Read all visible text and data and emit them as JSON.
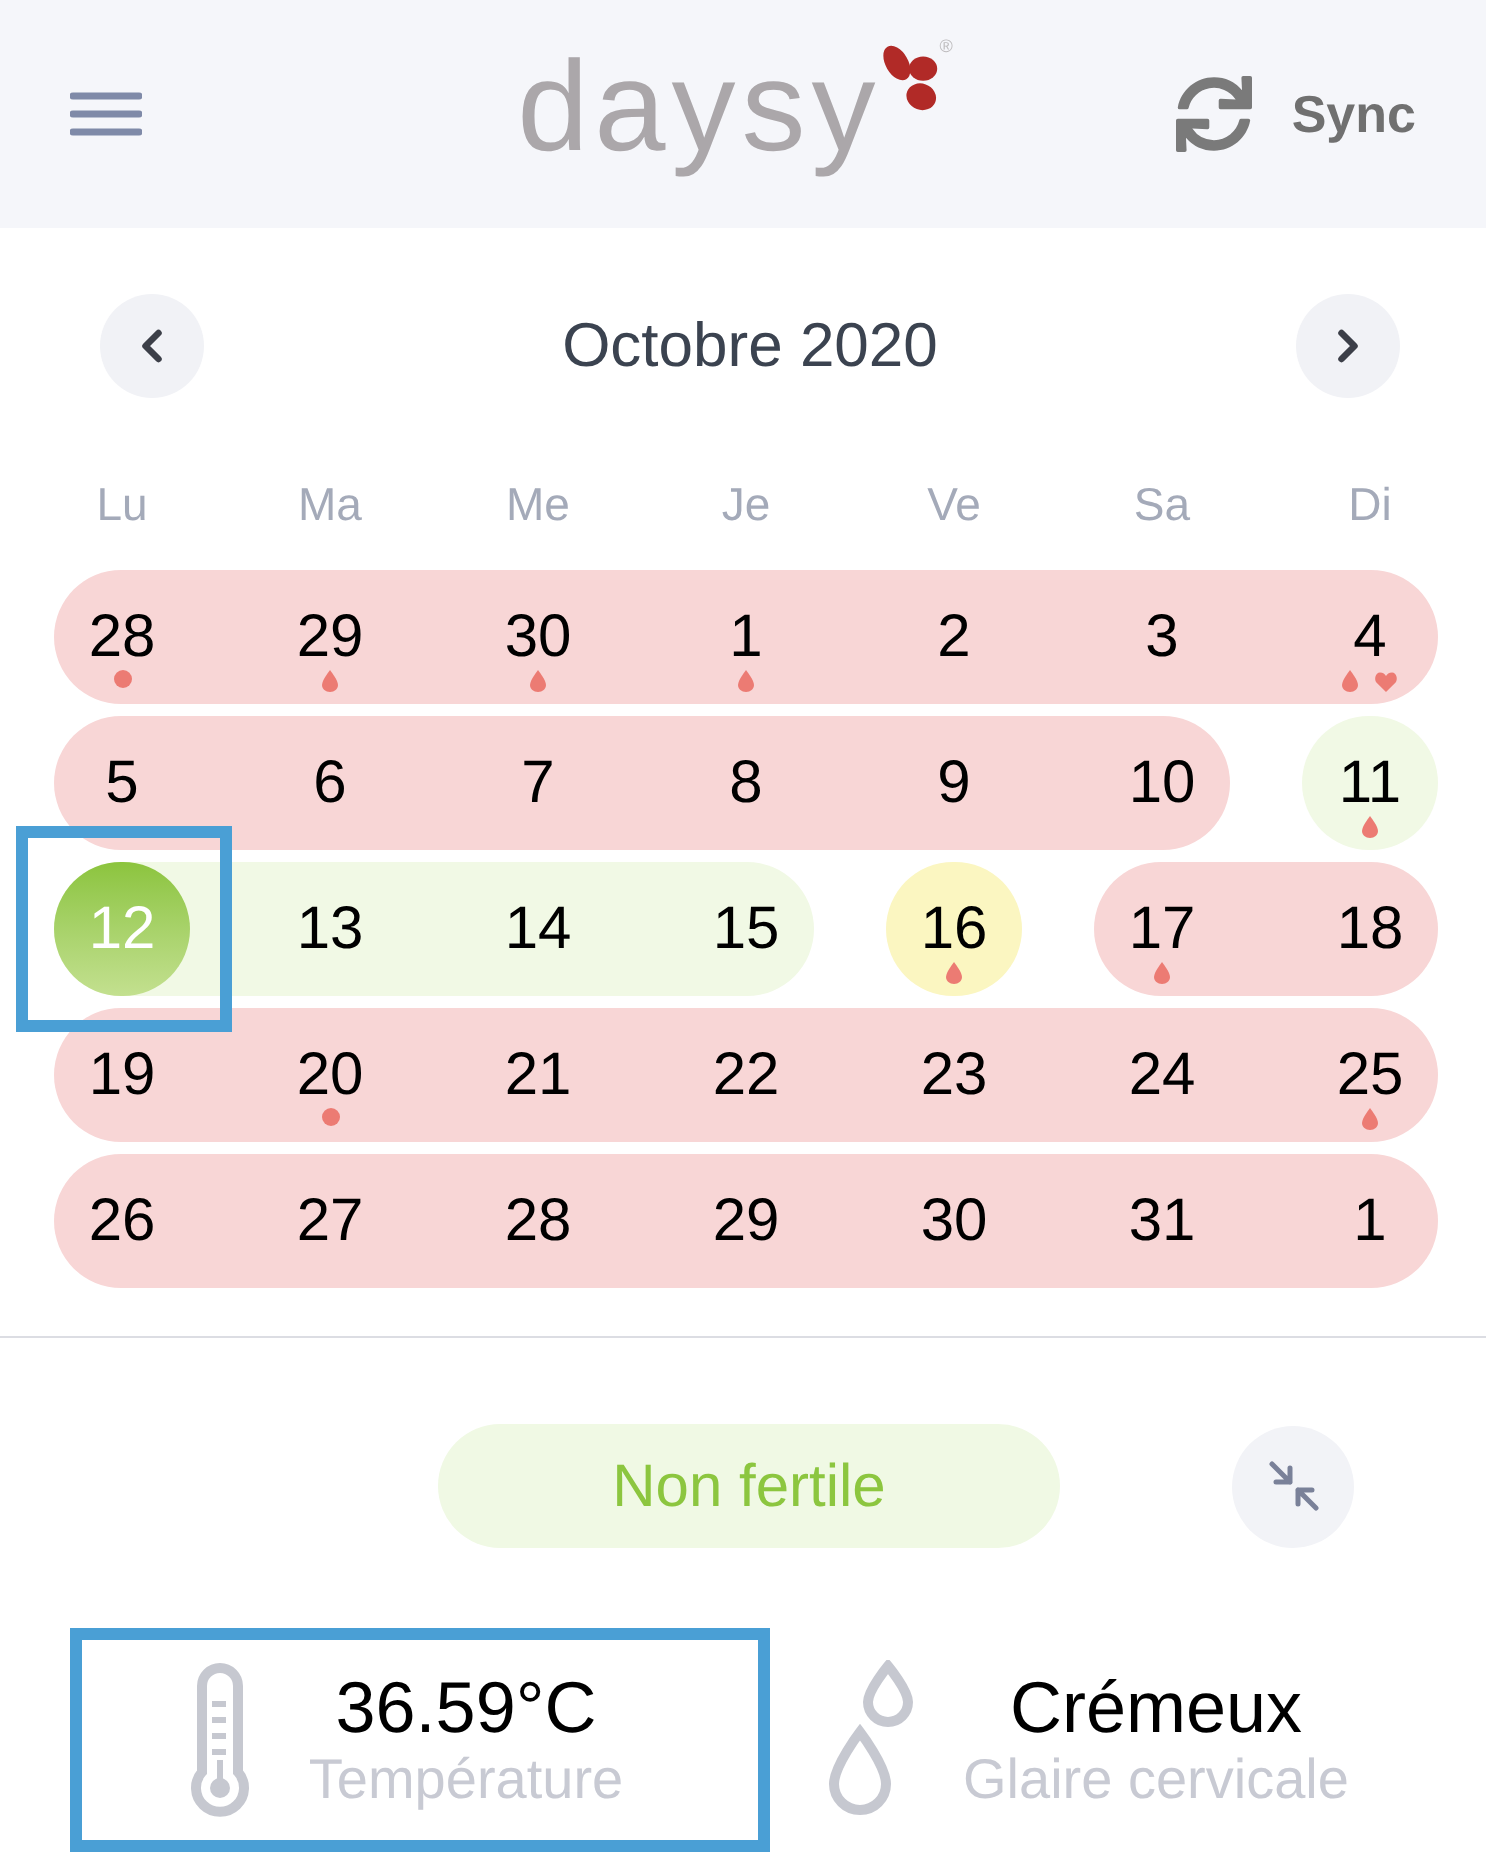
{
  "header": {
    "logo": {
      "text": "daysy",
      "registered": "®"
    },
    "sync": {
      "label": "Sync"
    }
  },
  "calendar": {
    "month": "Octobre 2020",
    "weekdays": [
      "Lu",
      "Ma",
      "Me",
      "Je",
      "Ve",
      "Sa",
      "Di"
    ],
    "weeks": [
      {
        "segments": [
          {
            "color": "#f8d6d6",
            "days": [
              {
                "label": "28",
                "selected": false,
                "highlighted": false,
                "marks": [
                  {
                    "kind": "dot"
                  }
                ]
              },
              {
                "label": "29",
                "selected": false,
                "highlighted": false,
                "marks": [
                  {
                    "kind": "drop"
                  }
                ]
              },
              {
                "label": "30",
                "selected": false,
                "highlighted": false,
                "marks": [
                  {
                    "kind": "drop"
                  }
                ]
              },
              {
                "label": "1",
                "selected": false,
                "highlighted": false,
                "marks": [
                  {
                    "kind": "drop"
                  }
                ]
              },
              {
                "label": "2",
                "selected": false,
                "highlighted": false
              },
              {
                "label": "3",
                "selected": false,
                "highlighted": false
              },
              {
                "label": "4",
                "selected": false,
                "highlighted": false,
                "marks": [
                  {
                    "kind": "drop"
                  },
                  {
                    "kind": "heart"
                  }
                ]
              }
            ]
          }
        ]
      },
      {
        "segments": [
          {
            "color": "#f8d6d6",
            "days": [
              {
                "label": "5",
                "selected": false,
                "highlighted": false
              },
              {
                "label": "6",
                "selected": false,
                "highlighted": false
              },
              {
                "label": "7",
                "selected": false,
                "highlighted": false
              },
              {
                "label": "8",
                "selected": false,
                "highlighted": false
              },
              {
                "label": "9",
                "selected": false,
                "highlighted": false
              },
              {
                "label": "10",
                "selected": false,
                "highlighted": false
              }
            ]
          },
          {
            "color": "#f1f9e5",
            "days": [
              {
                "label": "11",
                "selected": false,
                "highlighted": false,
                "marks": [
                  {
                    "kind": "drop"
                  }
                ]
              }
            ]
          }
        ]
      },
      {
        "segments": [
          {
            "color": "#f1f9e5",
            "days": [
              {
                "label": "12",
                "selected": true,
                "highlighted": true
              },
              {
                "label": "13",
                "selected": false,
                "highlighted": false
              },
              {
                "label": "14",
                "selected": false,
                "highlighted": false
              },
              {
                "label": "15",
                "selected": false,
                "highlighted": false
              }
            ]
          },
          {
            "color": "#fbf6c1",
            "days": [
              {
                "label": "16",
                "selected": false,
                "highlighted": false,
                "marks": [
                  {
                    "kind": "drop"
                  }
                ]
              }
            ]
          },
          {
            "color": "#f8d6d6",
            "days": [
              {
                "label": "17",
                "selected": false,
                "highlighted": false,
                "marks": [
                  {
                    "kind": "drop"
                  }
                ]
              },
              {
                "label": "18",
                "selected": false,
                "highlighted": false
              }
            ]
          }
        ]
      },
      {
        "segments": [
          {
            "color": "#f8d6d6",
            "days": [
              {
                "label": "19",
                "selected": false,
                "highlighted": false
              },
              {
                "label": "20",
                "selected": false,
                "highlighted": false,
                "marks": [
                  {
                    "kind": "dot"
                  }
                ]
              },
              {
                "label": "21",
                "selected": false,
                "highlighted": false
              },
              {
                "label": "22",
                "selected": false,
                "highlighted": false
              },
              {
                "label": "23",
                "selected": false,
                "highlighted": false
              },
              {
                "label": "24",
                "selected": false,
                "highlighted": false
              },
              {
                "label": "25",
                "selected": false,
                "highlighted": false,
                "marks": [
                  {
                    "kind": "drop"
                  }
                ]
              }
            ]
          }
        ]
      },
      {
        "segments": [
          {
            "color": "#f8d6d6",
            "days": [
              {
                "label": "26",
                "selected": false,
                "highlighted": false
              },
              {
                "label": "27",
                "selected": false,
                "highlighted": false
              },
              {
                "label": "28",
                "selected": false,
                "highlighted": false
              },
              {
                "label": "29",
                "selected": false,
                "highlighted": false
              },
              {
                "label": "30",
                "selected": false,
                "highlighted": false
              },
              {
                "label": "31",
                "selected": false,
                "highlighted": false
              },
              {
                "label": "1",
                "selected": false,
                "highlighted": false
              }
            ]
          }
        ]
      }
    ]
  },
  "status": {
    "label": "Non fertile"
  },
  "readings": [
    {
      "kind": "temperature",
      "value": "36.59°C",
      "label": "Température",
      "highlighted": true
    },
    {
      "kind": "mucus",
      "value": "Crémeux",
      "label": "Glaire cervicale",
      "highlighted": false
    }
  ]
}
